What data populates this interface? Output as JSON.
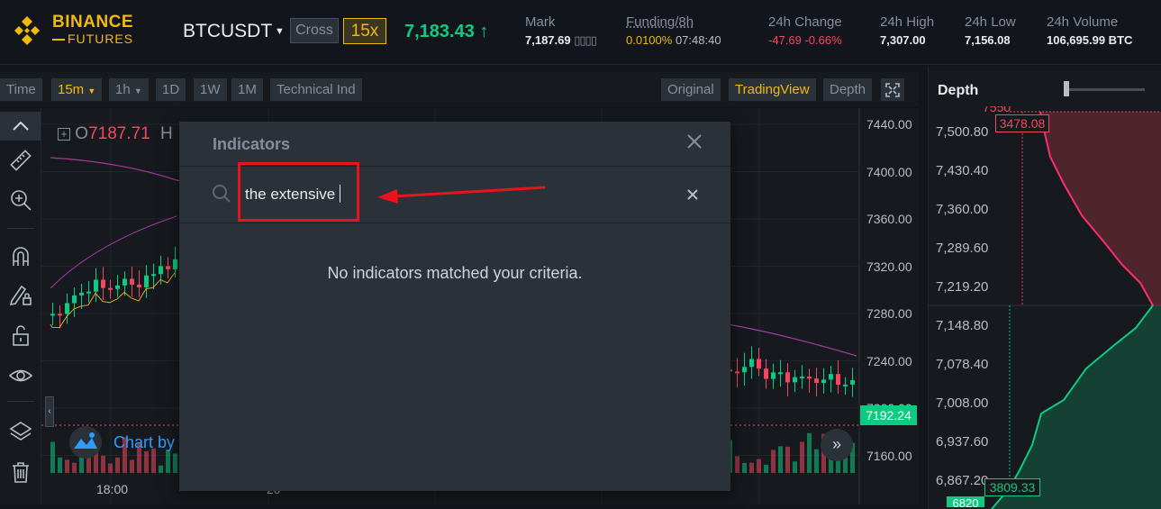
{
  "brand": {
    "line1": "BINANCE",
    "line2": "FUTURES",
    "color": "#f0b90b"
  },
  "ticker": {
    "symbol": "BTCUSDT",
    "margin_mode": "Cross",
    "leverage": "15x",
    "last_price": "7,183.43",
    "last_price_arrow": "↑"
  },
  "stats": {
    "mark_label": "Mark",
    "mark_value": "7,187.69",
    "funding_label": "Funding/8h",
    "funding_rate": "0.0100%",
    "funding_countdown": "07:48:40",
    "change_label": "24h Change",
    "change_value": "-47.69 -0.66%",
    "high_label": "24h High",
    "high_value": "7,307.00",
    "low_label": "24h Low",
    "low_value": "7,156.08",
    "volume_label": "24h Volume",
    "volume_value": "106,695.99 BTC"
  },
  "toolbar": {
    "intervals": [
      "Time",
      "15m",
      "1h",
      "1D",
      "1W",
      "1M"
    ],
    "active_interval": "15m",
    "technical_ind": "Technical Ind",
    "views": [
      "Original",
      "TradingView",
      "Depth"
    ],
    "active_view": "TradingView"
  },
  "chart": {
    "legend_open_prefix": "O",
    "legend_open_value": "7187.71",
    "legend_high_prefix": "H",
    "price_axis": [
      "7440.00",
      "7400.00",
      "7360.00",
      "7320.00",
      "7280.00",
      "7240.00",
      "7200.00",
      "7160.00"
    ],
    "current_price": "7192.24",
    "time_labels": [
      "18:00",
      "20"
    ],
    "chart_by": "Chart by",
    "colors": {
      "up": "#0ecb81",
      "down": "#f6465d"
    }
  },
  "depth": {
    "title": "Depth",
    "price_axis": [
      "7,500.80",
      "7,430.40",
      "7,360.00",
      "7,289.60",
      "7,219.20",
      "7,148.80",
      "7,078.40",
      "7,008.00",
      "6,937.60",
      "6,867.20"
    ],
    "top_cut_label": "7550",
    "bottom_cut_label": "6820",
    "ask_tag": "3478.08",
    "bid_tag": "3809.33"
  },
  "indicators_modal": {
    "title": "Indicators",
    "search_value": "the extensive",
    "search_placeholder": "Search",
    "empty_message": "No indicators matched your criteria."
  },
  "annotation": {
    "color": "#e8141c"
  }
}
